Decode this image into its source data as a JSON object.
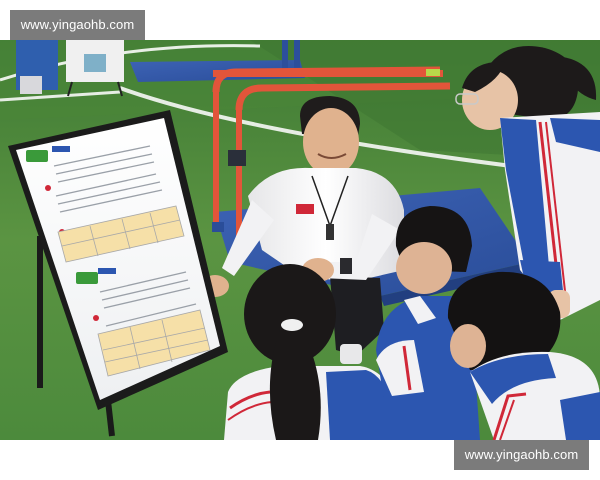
{
  "watermarks": {
    "top": "www.yingaohb.com",
    "bottom": "www.yingaohb.com"
  },
  "photo": {
    "colors": {
      "turf": "#4f8a3a",
      "turf_light": "#6da04d",
      "mat": "#3558a8",
      "rail": "#e2553a",
      "coach_shirt": "#f4f4f4",
      "uniform_blue": "#2c56b0",
      "uniform_white": "#f2f2f4",
      "uniform_red": "#d02838"
    }
  }
}
